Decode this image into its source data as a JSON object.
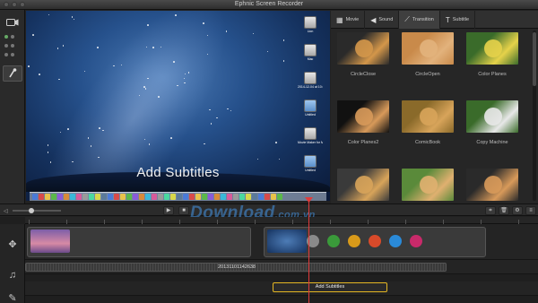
{
  "window": {
    "title": "Ephnic Screen Recorder"
  },
  "preview": {
    "subtitle_text": "Add Subtitles",
    "desktop_icons": [
      {
        "label": "Lion",
        "kind": "drive"
      },
      {
        "label": "Mac",
        "kind": "drive"
      },
      {
        "label": "2014-12-04 at 10.01",
        "kind": "file"
      },
      {
        "label": "Untitled",
        "kind": "folder"
      },
      {
        "label": "Movie Maker for Mac",
        "kind": "file"
      },
      {
        "label": "Untitled",
        "kind": "folder"
      }
    ]
  },
  "tabs": [
    {
      "label": "Movie",
      "icon": "film-icon",
      "glyph": "▦",
      "active": false
    },
    {
      "label": "Sound",
      "icon": "speaker-icon",
      "glyph": "◀",
      "active": false
    },
    {
      "label": "Transition",
      "icon": "wand-icon",
      "glyph": "⟋",
      "active": true
    },
    {
      "label": "Subtitle",
      "icon": "text-icon",
      "glyph": "T",
      "active": false
    }
  ],
  "transitions": [
    {
      "label": "CircleClose",
      "bg": "#2a2a2a",
      "accent": "#d4974a"
    },
    {
      "label": "CircleOpen",
      "bg": "#c98a4a",
      "accent": "#e2b27c"
    },
    {
      "label": "Color Planes",
      "bg": "#3a6b2a",
      "accent": "#e6d24a"
    },
    {
      "label": "Color Planes2",
      "bg": "#111111",
      "accent": "#d89a5a"
    },
    {
      "label": "ComicBook",
      "bg": "#8a6a2a",
      "accent": "#d8a45a"
    },
    {
      "label": "Copy Machine",
      "bg": "#3a6b2a",
      "accent": "#e8e8e8"
    },
    {
      "label": "",
      "bg": "#3a3a3a",
      "accent": "#d8a45a"
    },
    {
      "label": "",
      "bg": "#5a8a3a",
      "accent": "#e0b070"
    },
    {
      "label": "",
      "bg": "#2a2a2a",
      "accent": "#d89a5a"
    }
  ],
  "timeline": {
    "audio_label": "20131101142638",
    "subtitle_clip_label": "Add Subtitles",
    "color_dots": [
      "#8a8a8a",
      "#3a9a3a",
      "#d89a1a",
      "#d84a2a",
      "#2a8ad8",
      "#c82a6a"
    ]
  },
  "watermark": {
    "main": "Download",
    "suffix": ".com.vn"
  },
  "colors": {
    "playhead": "#e23b3b",
    "subtitle_border": "#e4b622"
  }
}
